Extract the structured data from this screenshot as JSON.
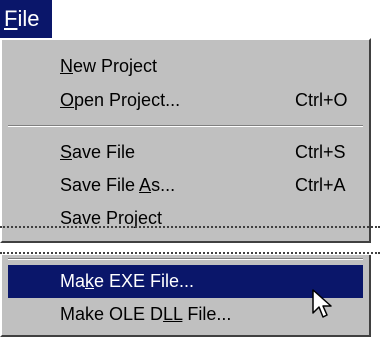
{
  "menubar": {
    "file_label": "File",
    "file_mnemonic": "F",
    "file_rest": "ile"
  },
  "menu": {
    "new_project": {
      "pre": "",
      "mn": "N",
      "post": "ew Project",
      "shortcut": ""
    },
    "open_project": {
      "pre": "",
      "mn": "O",
      "post": "pen Project...",
      "shortcut": "Ctrl+O"
    },
    "save_file": {
      "pre": "",
      "mn": "S",
      "post": "ave File",
      "shortcut": "Ctrl+S"
    },
    "save_file_as": {
      "pre": "Save File ",
      "mn": "A",
      "post": "s...",
      "shortcut": "Ctrl+A"
    },
    "save_project": {
      "pre": "Save Project",
      "mn": "",
      "post": "",
      "shortcut": ""
    },
    "make_exe": {
      "pre": "Ma",
      "mn": "k",
      "post": "e EXE File...",
      "shortcut": ""
    },
    "make_ole": {
      "pre": "Make OLE D",
      "mn": "LL",
      "post": " File...",
      "shortcut": ""
    }
  },
  "colors": {
    "highlight": "#0a166a",
    "menu_bg": "#c0c0c0"
  },
  "icons": {
    "cursor": "arrow-pointer-icon"
  }
}
